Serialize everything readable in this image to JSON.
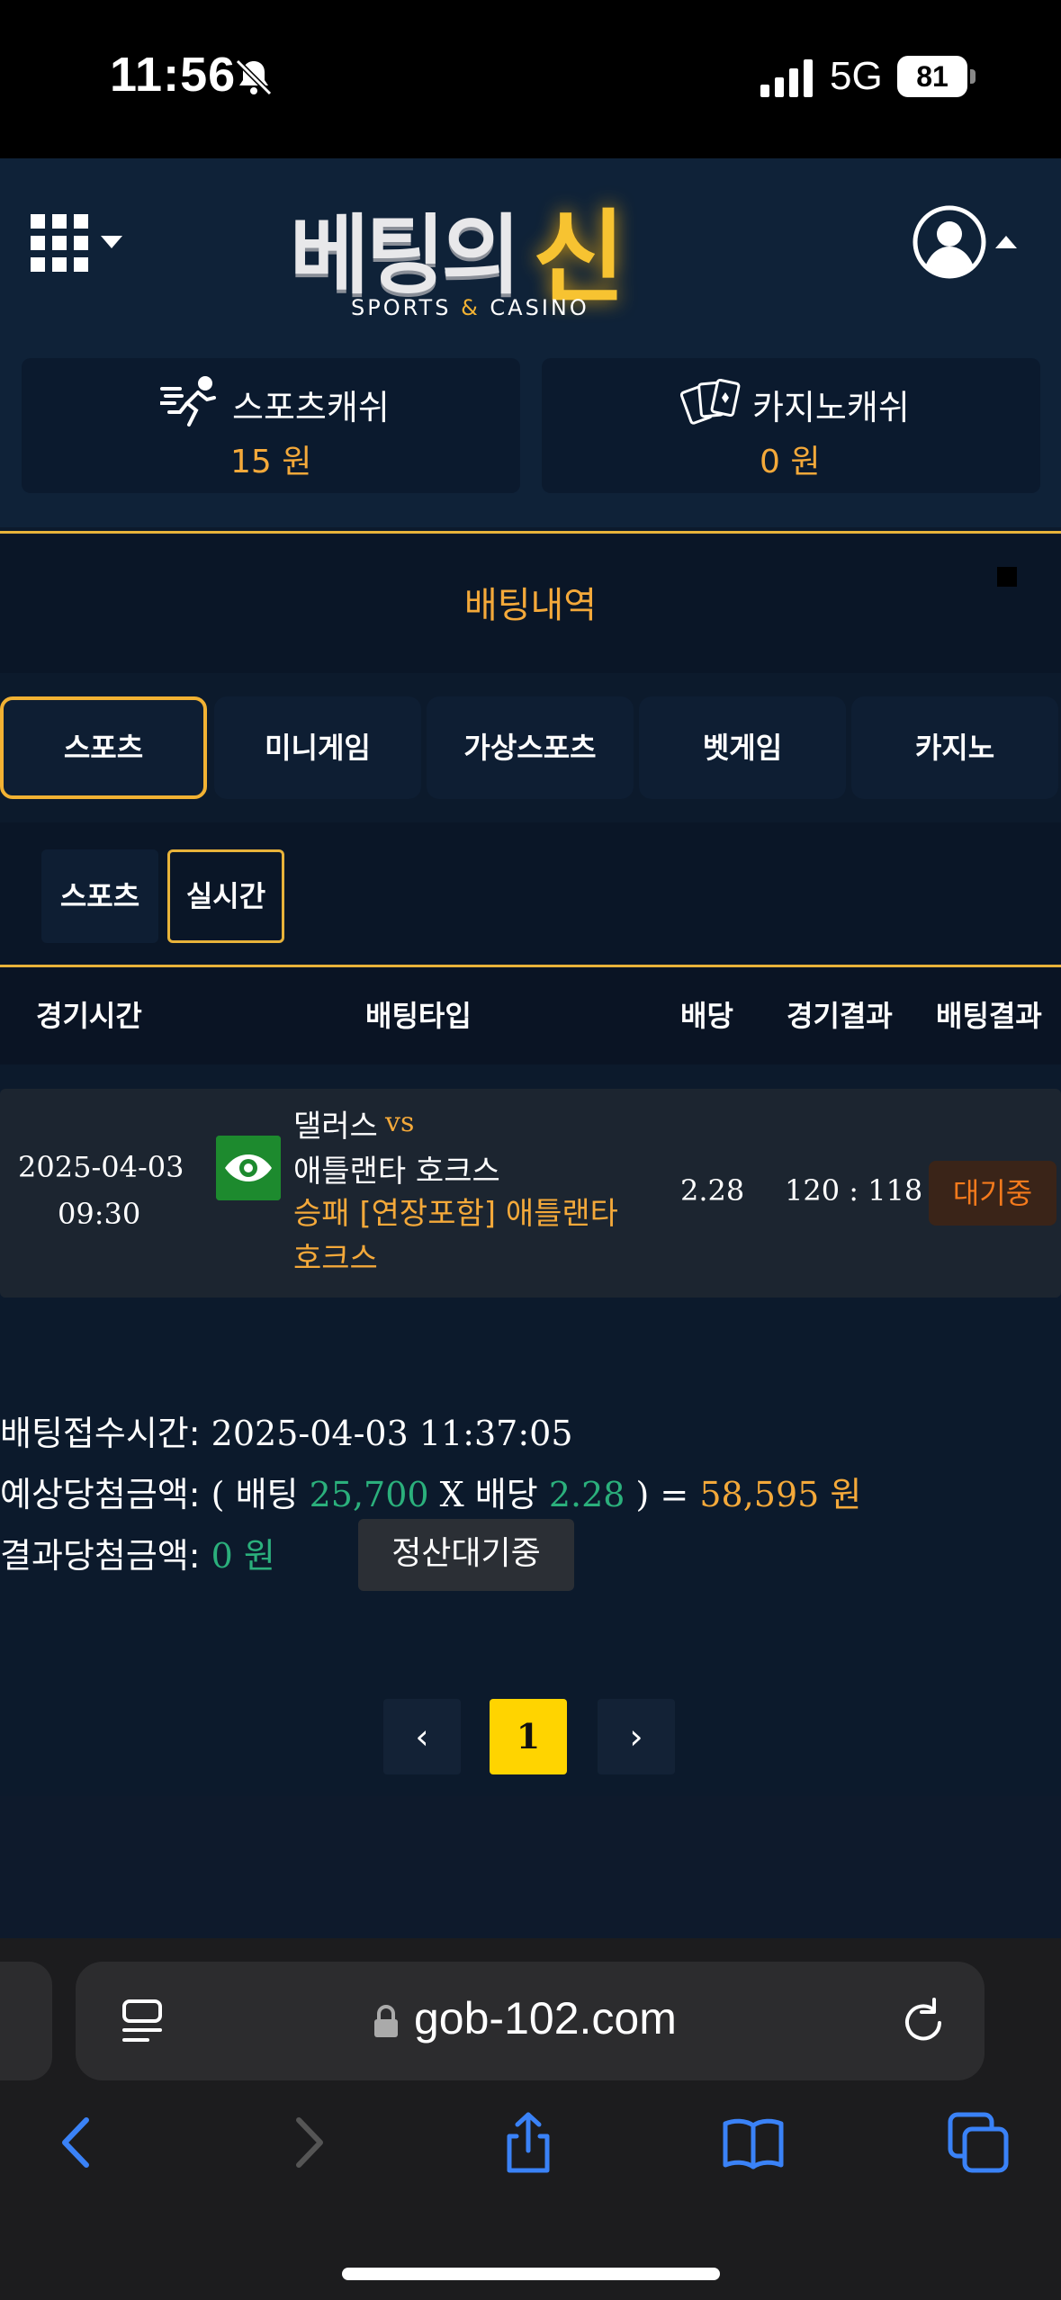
{
  "status_bar": {
    "time": "11:56",
    "network": "5G",
    "battery": "81"
  },
  "header": {
    "logo_main": "베팅의",
    "logo_accent": "신",
    "logo_sub_left": "SPORTS",
    "logo_sub_amp": "&",
    "logo_sub_right": "CASINO",
    "sports_cash_label": "스포츠캐쉬",
    "sports_cash_value": "15 원",
    "casino_cash_label": "카지노캐쉬",
    "casino_cash_value": "0 원"
  },
  "page_title": "배팅내역",
  "main_tabs": [
    {
      "label": "스포츠",
      "active": true
    },
    {
      "label": "미니게임"
    },
    {
      "label": "가상스포츠"
    },
    {
      "label": "벳게임"
    },
    {
      "label": "카지노"
    }
  ],
  "sub_tabs": [
    {
      "label": "스포츠"
    },
    {
      "label": "실시간",
      "active": true
    }
  ],
  "table": {
    "headers": [
      "경기시간",
      "배팅타입",
      "배당",
      "경기결과",
      "배팅결과"
    ],
    "rows": [
      {
        "date": "2025-04-03",
        "time": "09:30",
        "home": "댈러스",
        "vs": "vs",
        "away": "애틀랜타 호크스",
        "pick": "승패 [연장포함] 애틀랜타 호크스",
        "odds": "2.28",
        "score": "120 : 118",
        "status": "대기중"
      }
    ]
  },
  "summary": {
    "received_label": "배팅접수시간:",
    "received_value": "2025-04-03 11:37:05",
    "expected_label": "예상당첨금액:",
    "expected_open": "( 배팅",
    "bet_amount": "25,700",
    "x_odds": "X 배당",
    "odds": "2.28",
    "close_eq": ") =",
    "expected_amount": "58,595 원",
    "result_label": "결과당첨금액:",
    "result_amount": "0 원",
    "settle_status": "정산대기중"
  },
  "pagination": {
    "prev": "‹",
    "current": "1",
    "next": "›"
  },
  "browser": {
    "url": "gob-102.com"
  },
  "colors": {
    "accent_gold": "#f2b233",
    "orange": "#f4a93a",
    "green": "#2bb07c",
    "background": "#0c1a2c"
  }
}
